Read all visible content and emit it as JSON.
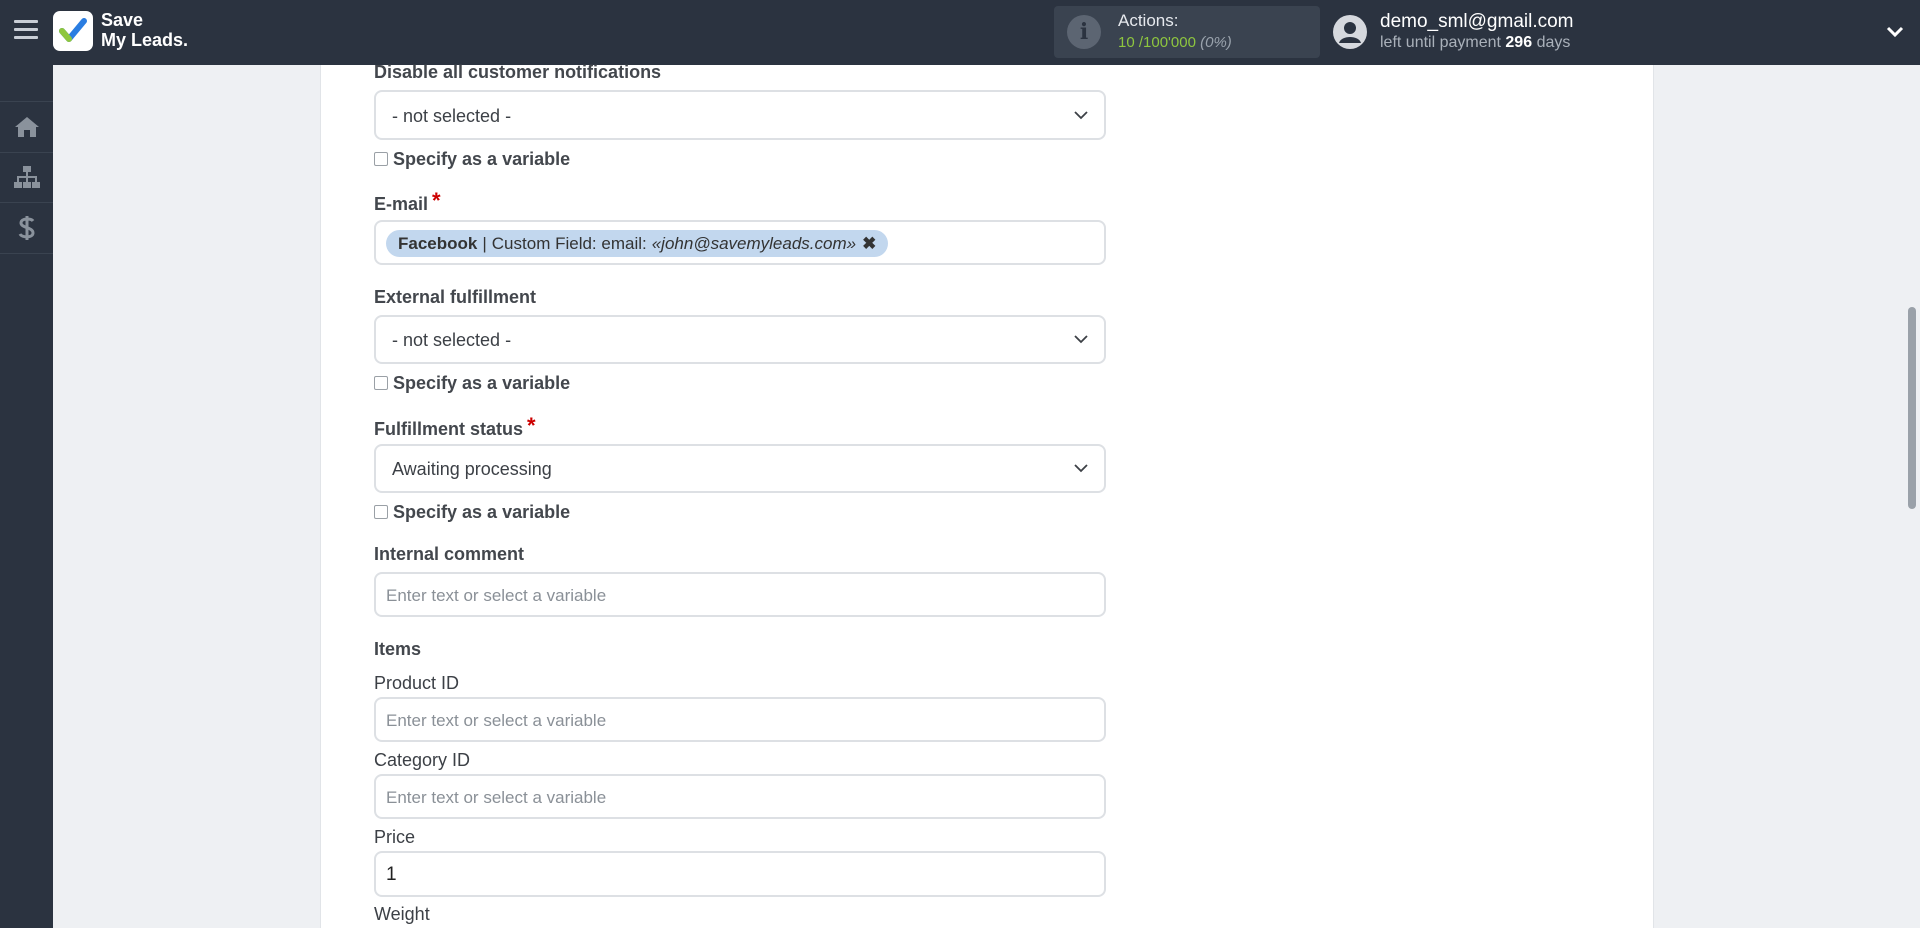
{
  "header": {
    "logo_line1": "Save",
    "logo_line2": "My Leads.",
    "actions_label": "Actions:",
    "actions_used": "10",
    "actions_total": "/100'000",
    "actions_pct": "(0%)",
    "user_email": "demo_sml@gmail.com",
    "payment_prefix": "left until payment",
    "payment_days": "296",
    "payment_suffix": "days"
  },
  "sidebar": {
    "items": [
      {
        "icon": "home-icon"
      },
      {
        "icon": "sitemap-icon"
      },
      {
        "icon": "dollar-icon"
      }
    ]
  },
  "form": {
    "disable_notifications": {
      "label": "Disable all customer notifications",
      "value": "- not selected -",
      "variable_label": "Specify as a variable"
    },
    "email": {
      "label": "E-mail",
      "required_mark": "*",
      "tag_source": "Facebook",
      "tag_separator": "|",
      "tag_field": "Custom Field: email:",
      "tag_value": "«john@savemyleads.com»",
      "tag_remove": "✖"
    },
    "external_fulfillment": {
      "label": "External fulfillment",
      "value": "- not selected -",
      "variable_label": "Specify as a variable"
    },
    "fulfillment_status": {
      "label": "Fulfillment status",
      "required_mark": "*",
      "value": "Awaiting processing",
      "variable_label": "Specify as a variable"
    },
    "internal_comment": {
      "label": "Internal comment",
      "placeholder": "Enter text or select a variable"
    },
    "items_heading": "Items",
    "product_id": {
      "label": "Product ID",
      "placeholder": "Enter text or select a variable"
    },
    "category_id": {
      "label": "Category ID",
      "placeholder": "Enter text or select a variable"
    },
    "price": {
      "label": "Price",
      "value": "1"
    },
    "weight": {
      "label": "Weight"
    }
  },
  "colors": {
    "topbar": "#2b3340",
    "accent_green": "#8ec63f",
    "required_red": "#cc0000",
    "tag_bg": "#c2d7ee"
  }
}
